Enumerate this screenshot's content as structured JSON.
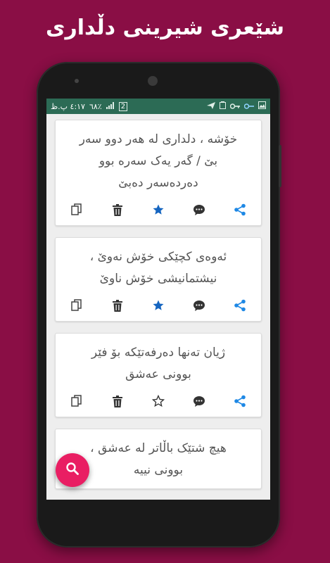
{
  "promo": {
    "title": "شێعری شیرینی دڵداری"
  },
  "statusbar": {
    "time": "٤:١٧ پ.ظ",
    "battery": "٦٨٪",
    "sim": "2"
  },
  "poems": [
    {
      "lines": [
        "خۆشه ، دلداری له هەر دوو سەر",
        "بێ / گەر یەک سەرە بوو",
        "دەردەسەر دەبێ"
      ],
      "starred": true
    },
    {
      "lines": [
        "ئەوەی کچێکی خۆش نەوێ ،",
        "نیشتمانیشی خۆش ناوێ"
      ],
      "starred": true
    },
    {
      "lines": [
        "ژیان تەنها دەرفەتێکە بۆ فێر",
        "بوونی عەشق"
      ],
      "starred": false
    },
    {
      "lines": [
        "هیچ شتێک باڵاتر لە عەشق ،",
        "بوونی نییە"
      ],
      "starred": false
    }
  ],
  "colors": {
    "background": "#8a0e45",
    "statusbar": "#2c6b55",
    "star": "#1565c0",
    "share": "#1e88e5",
    "fab": "#e91e63"
  }
}
